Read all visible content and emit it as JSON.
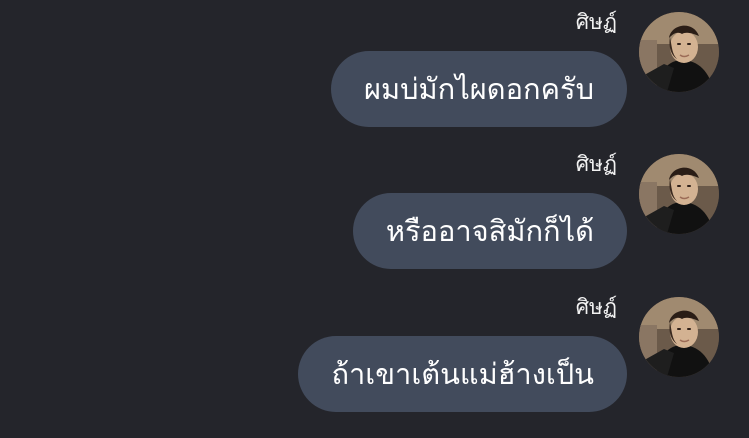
{
  "conversation": {
    "messages": [
      {
        "sender": "ศิษฏ์",
        "text": "ผมบ่มักไผดอกครับ",
        "avatar_icon": "profile-photo-icon"
      },
      {
        "sender": "ศิษฏ์",
        "text": "หรืออาจสิมักก็ได้",
        "avatar_icon": "profile-photo-icon"
      },
      {
        "sender": "ศิษฏ์",
        "text": "ถ้าเขาเต้นแม่ฮ้างเป็น",
        "avatar_icon": "profile-photo-icon"
      }
    ]
  },
  "theme": {
    "background": "#24252b",
    "bubble": "#424b5c",
    "text": "#ffffff",
    "name": "#f2f2f2"
  }
}
